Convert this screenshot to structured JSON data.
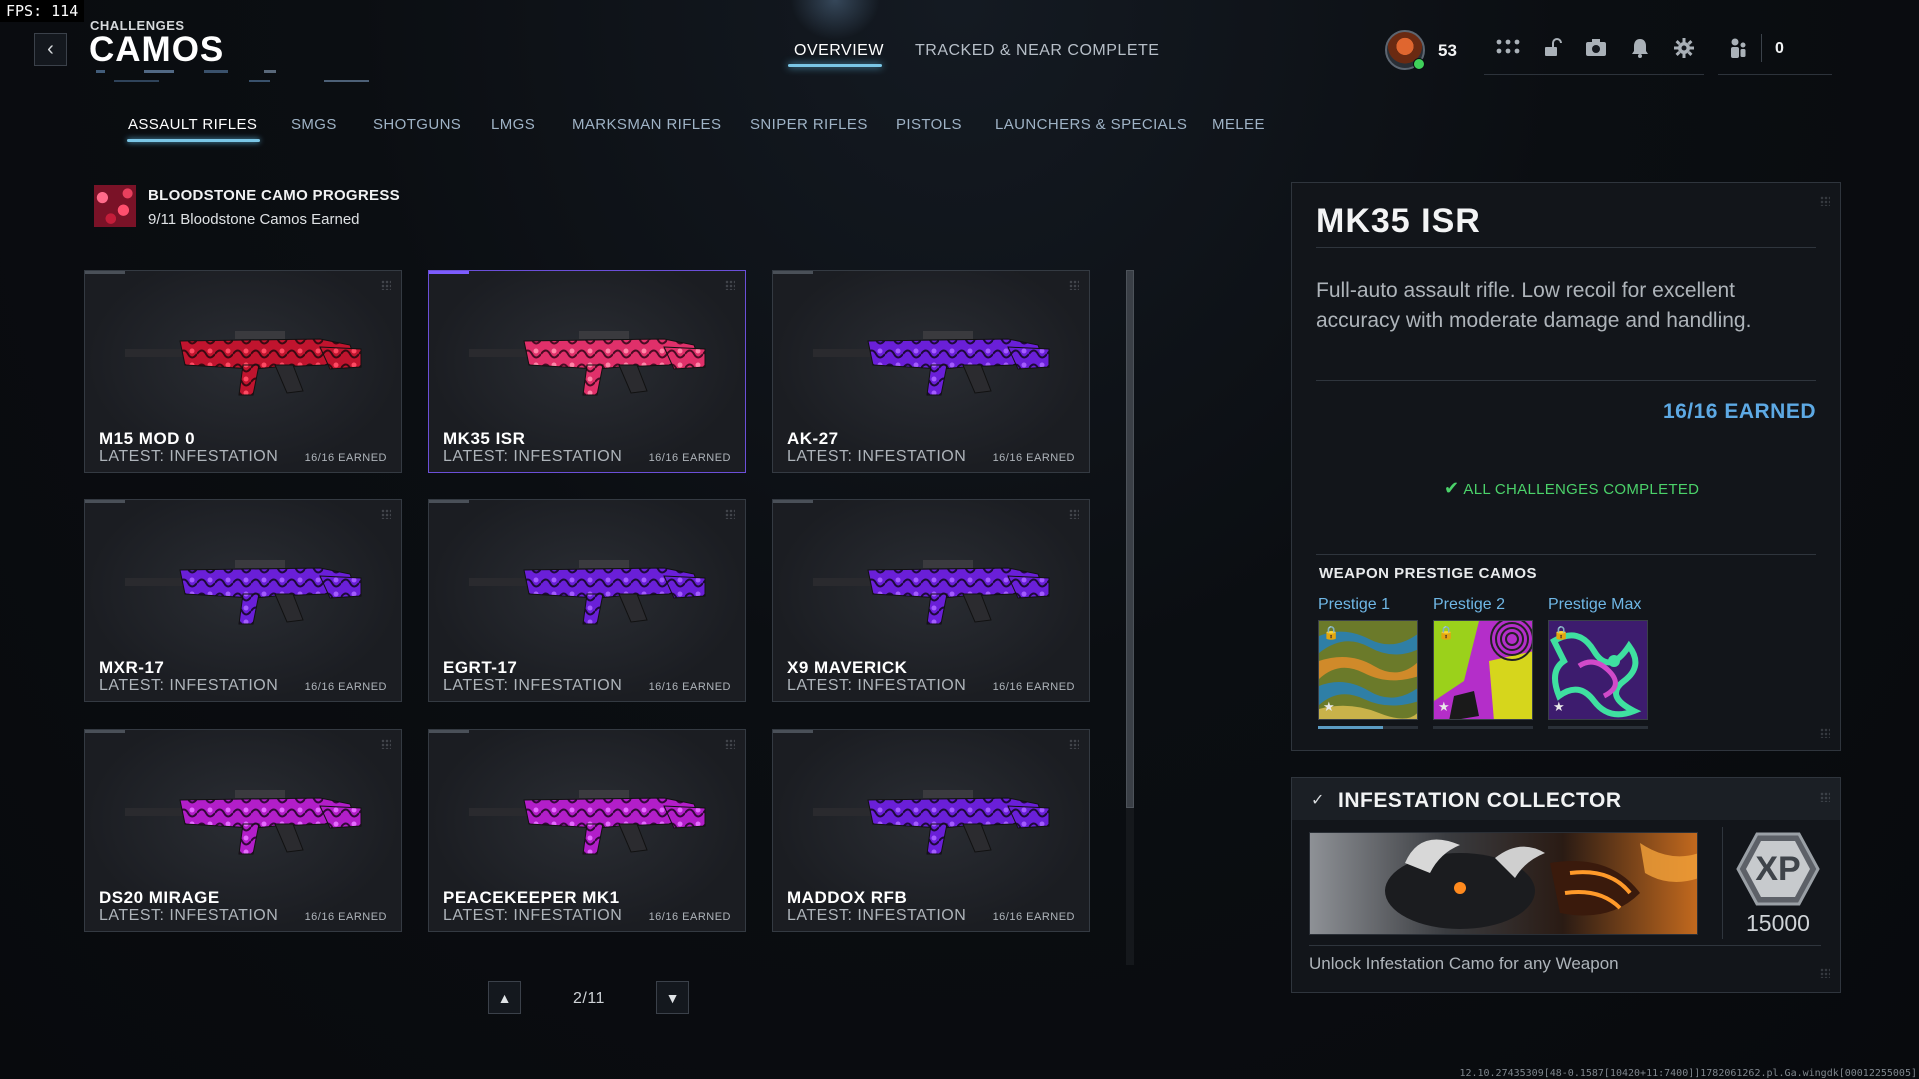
{
  "fps": "FPS: 114",
  "header": {
    "eyebrow": "CHALLENGES",
    "title": "CAMOS",
    "tabs": [
      {
        "label": "OVERVIEW",
        "active": true
      },
      {
        "label": "TRACKED & NEAR COMPLETE",
        "active": false
      }
    ],
    "player_level": "53",
    "currency": "0"
  },
  "categories": [
    {
      "label": "ASSAULT RIFLES",
      "active": true
    },
    {
      "label": "SMGS",
      "active": false
    },
    {
      "label": "SHOTGUNS",
      "active": false
    },
    {
      "label": "LMGS",
      "active": false
    },
    {
      "label": "MARKSMAN RIFLES",
      "active": false
    },
    {
      "label": "SNIPER RIFLES",
      "active": false
    },
    {
      "label": "PISTOLS",
      "active": false
    },
    {
      "label": "LAUNCHERS & SPECIALS",
      "active": false
    },
    {
      "label": "MELEE",
      "active": false
    }
  ],
  "progress": {
    "title": "BLOODSTONE CAMO PROGRESS",
    "subtitle": "9/11 Bloodstone Camos Earned"
  },
  "weapons": [
    {
      "name": "M15 MOD 0",
      "latest": "LATEST: INFESTATION",
      "earned": "16/16 EARNED",
      "camo": "bloodstone-red",
      "selected": false
    },
    {
      "name": "MK35 ISR",
      "latest": "LATEST: INFESTATION",
      "earned": "16/16 EARNED",
      "camo": "bloodstone-pink",
      "selected": true
    },
    {
      "name": "AK-27",
      "latest": "LATEST: INFESTATION",
      "earned": "16/16 EARNED",
      "camo": "purple",
      "selected": false
    },
    {
      "name": "MXR-17",
      "latest": "LATEST: INFESTATION",
      "earned": "16/16 EARNED",
      "camo": "purple",
      "selected": false
    },
    {
      "name": "EGRT-17",
      "latest": "LATEST: INFESTATION",
      "earned": "16/16 EARNED",
      "camo": "purple",
      "selected": false
    },
    {
      "name": "X9 MAVERICK",
      "latest": "LATEST: INFESTATION",
      "earned": "16/16 EARNED",
      "camo": "purple",
      "selected": false
    },
    {
      "name": "DS20 MIRAGE",
      "latest": "LATEST: INFESTATION",
      "earned": "16/16 EARNED",
      "camo": "magenta",
      "selected": false
    },
    {
      "name": "PEACEKEEPER MK1",
      "latest": "LATEST: INFESTATION",
      "earned": "16/16 EARNED",
      "camo": "magenta",
      "selected": false
    },
    {
      "name": "MADDOX RFB",
      "latest": "LATEST: INFESTATION",
      "earned": "16/16 EARNED",
      "camo": "purple",
      "selected": false
    }
  ],
  "pagination": {
    "text": "2/11"
  },
  "detail": {
    "name": "MK35 ISR",
    "description": "Full-auto assault rifle. Low recoil for excellent accuracy with moderate damage and handling.",
    "earned": "16/16 EARNED",
    "status": "ALL CHALLENGES COMPLETED",
    "prestige_heading": "WEAPON PRESTIGE CAMOS",
    "prestige": [
      {
        "label": "Prestige 1",
        "progress": 0.65
      },
      {
        "label": "Prestige 2",
        "progress": 0
      },
      {
        "label": "Prestige Max",
        "progress": 0
      }
    ]
  },
  "collector": {
    "title": "INFESTATION COLLECTOR",
    "xp_label": "XP",
    "xp_amount": "15000",
    "description": "Unlock Infestation Camo for any Weapon"
  },
  "build_string": "12.10.27435309[48-0.1587[10420+11:7400]]1782061262.pl.Ga.wingdk[00012255005]",
  "colors": {
    "accent": "#7ac6e6",
    "earned": "#5da9e4",
    "success": "#4bd26a",
    "selection": "#7d5cff"
  }
}
